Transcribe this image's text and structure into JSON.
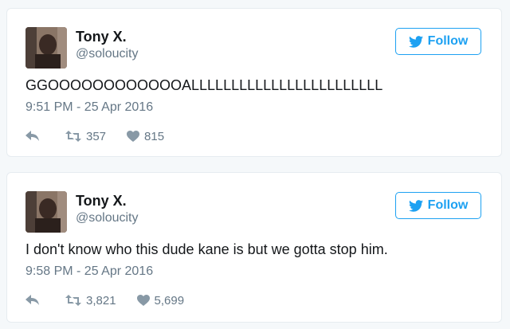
{
  "colors": {
    "accent": "#1da1f2",
    "text": "#14171a",
    "muted": "#657786",
    "icon": "#8899a6",
    "border": "#e6ecf0",
    "background": "#f5f8fa"
  },
  "tweets": [
    {
      "author": "Tony X.",
      "handle": "@soloucity",
      "follow_label": "Follow",
      "follow_icon": "twitter-bird-icon",
      "text": "GGOOOOOOOOOOOOALLLLLLLLLLLLLLLLLLLLLLLL",
      "timestamp": "9:51 PM - 25 Apr 2016",
      "retweets": "357",
      "likes": "815",
      "icons": {
        "reply": "reply-icon",
        "retweet": "retweet-icon",
        "like": "heart-icon"
      }
    },
    {
      "author": "Tony X.",
      "handle": "@soloucity",
      "follow_label": "Follow",
      "follow_icon": "twitter-bird-icon",
      "text": "I don't know who this dude kane is but we gotta stop him.",
      "timestamp": "9:58 PM - 25 Apr 2016",
      "retweets": "3,821",
      "likes": "5,699",
      "icons": {
        "reply": "reply-icon",
        "retweet": "retweet-icon",
        "like": "heart-icon"
      }
    }
  ]
}
